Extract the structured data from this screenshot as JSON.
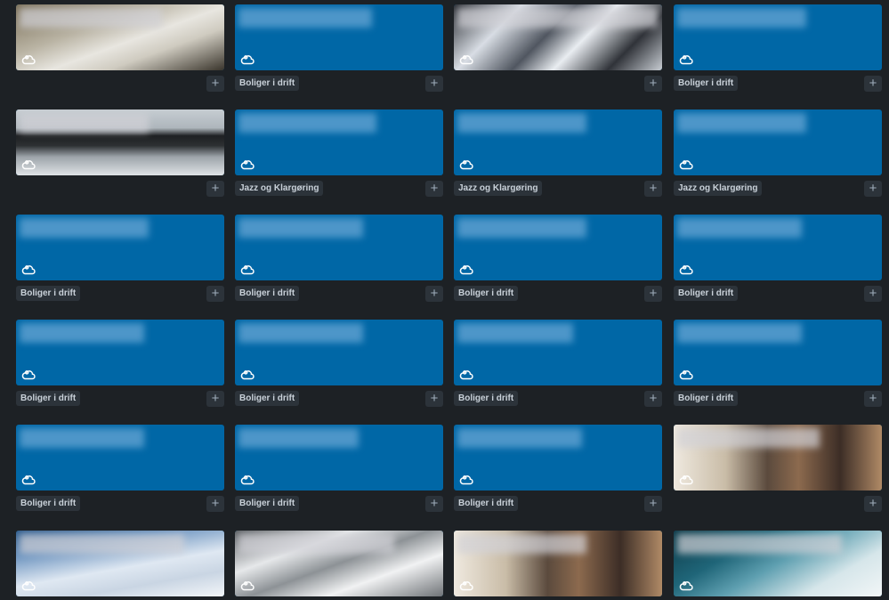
{
  "cards": [
    {
      "id": "r1c1",
      "photo": "bg-mtn-snow",
      "badge": null,
      "blur_w": 160
    },
    {
      "id": "r1c2",
      "photo": null,
      "badge": "Boliger i drift",
      "blur_w": 150
    },
    {
      "id": "r1c3",
      "photo": "bg-mtn-dark",
      "badge": null,
      "blur_w": 225
    },
    {
      "id": "r1c4",
      "photo": null,
      "badge": "Boliger i drift",
      "blur_w": 145
    },
    {
      "id": "r2c1",
      "photo": "bg-lake",
      "badge": null,
      "blur_w": 145
    },
    {
      "id": "r2c2",
      "photo": null,
      "badge": "Jazz og Klargøring",
      "blur_w": 155
    },
    {
      "id": "r2c3",
      "photo": null,
      "badge": "Jazz og Klargøring",
      "blur_w": 145
    },
    {
      "id": "r2c4",
      "photo": null,
      "badge": "Jazz og Klargøring",
      "blur_w": 145
    },
    {
      "id": "r3c1",
      "photo": null,
      "badge": "Boliger i drift",
      "blur_w": 145
    },
    {
      "id": "r3c2",
      "photo": null,
      "badge": "Boliger i drift",
      "blur_w": 140
    },
    {
      "id": "r3c3",
      "photo": null,
      "badge": "Boliger i drift",
      "blur_w": 145
    },
    {
      "id": "r3c4",
      "photo": null,
      "badge": "Boliger i drift",
      "blur_w": 140
    },
    {
      "id": "r4c1",
      "photo": null,
      "badge": "Boliger i drift",
      "blur_w": 140
    },
    {
      "id": "r4c2",
      "photo": null,
      "badge": "Boliger i drift",
      "blur_w": 140
    },
    {
      "id": "r4c3",
      "photo": null,
      "badge": "Boliger i drift",
      "blur_w": 130
    },
    {
      "id": "r4c4",
      "photo": null,
      "badge": "Boliger i drift",
      "blur_w": 140
    },
    {
      "id": "r5c1",
      "photo": null,
      "badge": "Boliger i drift",
      "blur_w": 140
    },
    {
      "id": "r5c2",
      "photo": null,
      "badge": "Boliger i drift",
      "blur_w": 135
    },
    {
      "id": "r5c3",
      "photo": null,
      "badge": "Boliger i drift",
      "blur_w": 140
    },
    {
      "id": "r5c4",
      "photo": "bg-town",
      "badge": null,
      "blur_w": 160
    },
    {
      "id": "r6c1",
      "photo": "bg-snow-blue",
      "badge": null,
      "blur_w": 185
    },
    {
      "id": "r6c2",
      "photo": "bg-snow-rock",
      "badge": null,
      "blur_w": 175
    },
    {
      "id": "r6c3",
      "photo": "bg-town",
      "badge": null,
      "blur_w": 145
    },
    {
      "id": "r6c4",
      "photo": "bg-ice",
      "badge": null,
      "blur_w": 185
    }
  ],
  "add_label": "+",
  "icons": {
    "card_icon": "team-cloud-icon",
    "add_icon": "plus-icon"
  },
  "colors": {
    "background": "#1d2125",
    "card_blue": "#0067a6",
    "badge_bg": "#2c333a"
  }
}
